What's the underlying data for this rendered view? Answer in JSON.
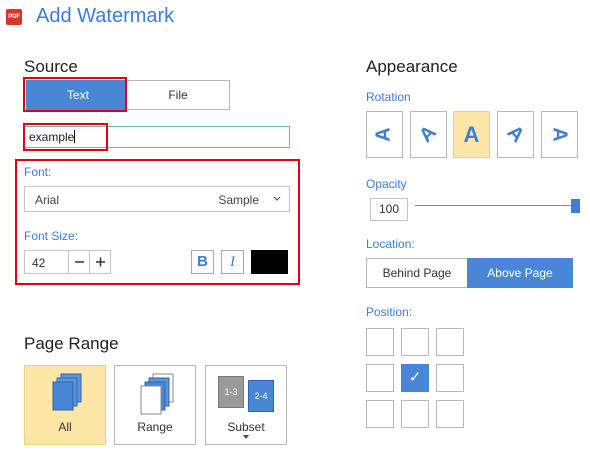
{
  "header": {
    "logo_text": "PDF",
    "title": "Add Watermark"
  },
  "source": {
    "title": "Source",
    "tabs": [
      {
        "label": "Text",
        "selected": true
      },
      {
        "label": "File",
        "selected": false
      }
    ],
    "text_value": "example",
    "font_label": "Font:",
    "font_name": "Arial",
    "font_sample": "Sample",
    "font_size_label": "Font Size:",
    "font_size": "42",
    "bold_label": "B",
    "italic_label": "I",
    "text_color": "#000000"
  },
  "page_range": {
    "title": "Page Range",
    "options": [
      {
        "label": "All",
        "selected": true
      },
      {
        "label": "Range",
        "selected": false
      },
      {
        "label": "Subset",
        "selected": false,
        "badge_a": "1-3",
        "badge_b": "2-4"
      }
    ]
  },
  "appearance": {
    "title": "Appearance",
    "rotation_label": "Rotation",
    "rotations": [
      {
        "glyph": "A",
        "selected": false
      },
      {
        "glyph": "A",
        "selected": false
      },
      {
        "glyph": "A",
        "selected": true
      },
      {
        "glyph": "A",
        "selected": false
      },
      {
        "glyph": "A",
        "selected": false
      }
    ],
    "opacity_label": "Opacity",
    "opacity_value": "100",
    "opacity_level": 1.0,
    "location_label": "Location:",
    "location_options": [
      {
        "label": "Behind Page",
        "selected": false
      },
      {
        "label": "Above Page",
        "selected": true
      }
    ],
    "position_label": "Position:",
    "position_selected_index": 4,
    "check_glyph": "✓"
  },
  "colors": {
    "accent": "#4a86d6",
    "title_blue": "#3b7dd8",
    "highlight": "#fde6a6",
    "annotation_red": "#e00011"
  }
}
